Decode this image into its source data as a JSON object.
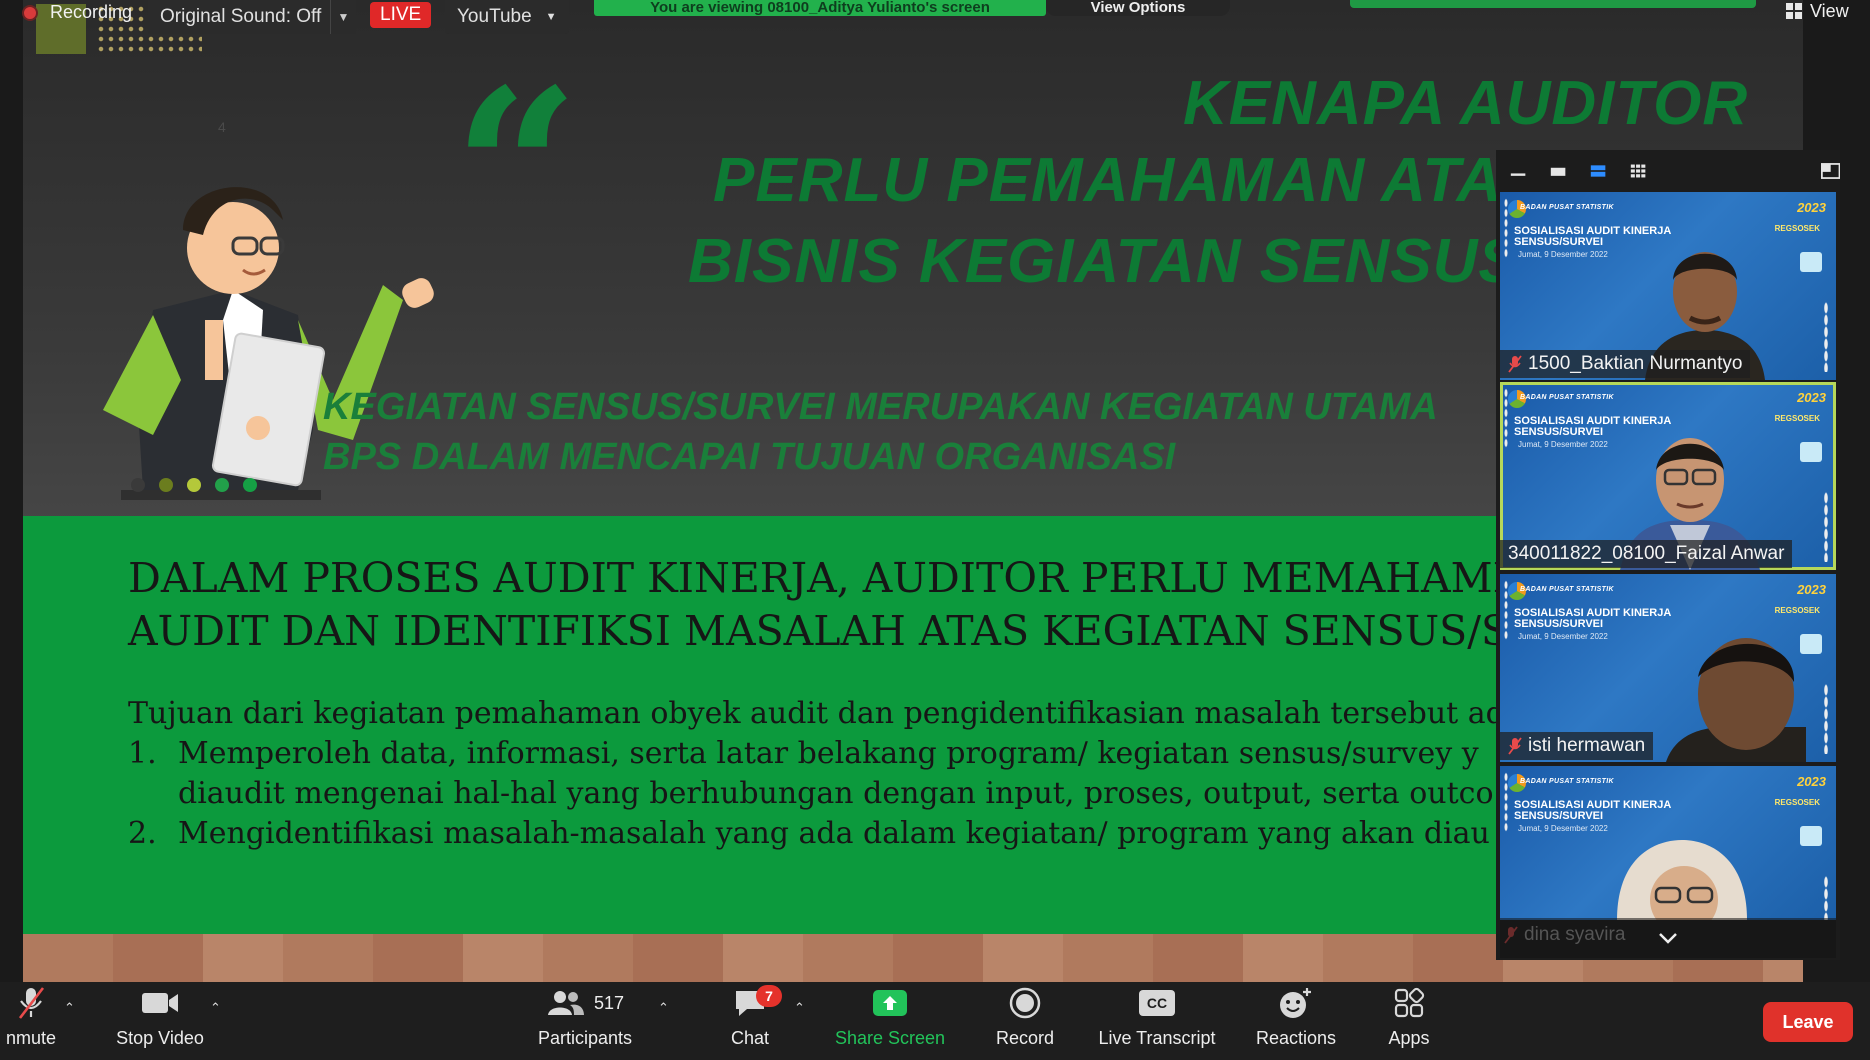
{
  "top_bar": {
    "recording_label": "Recording",
    "original_sound": "Original Sound: Off",
    "live_badge": "LIVE",
    "stream_target": "YouTube",
    "viewing_banner": "You are viewing 08100_Aditya Yulianto's screen",
    "view_options": "View Options",
    "view_label": "View"
  },
  "slide": {
    "heading_1": "KENAPA AUDITOR",
    "heading_2": "PERLU PEMAHAMAN ATAS PR",
    "heading_3": "BISNIS KEGIATAN SENSUS/SU",
    "subheading_1": "KEGIATAN SENSUS/SURVEI MERUPAKAN KEGIATAN UTAMA",
    "subheading_2": "BPS DALAM MENCAPAI TUJUAN ORGANISASI",
    "band_title_1": "DALAM PROSES AUDIT KINERJA, AUDITOR PERLU MEMAHAMI OBY",
    "band_title_2": "AUDIT DAN IDENTIFIKSI MASALAH ATAS KEGIATAN SENSUS/SURV",
    "intro": "Tujuan dari kegiatan pemahaman obyek audit dan pengidentifikasian masalah tersebut ad",
    "item_1_num": "1.",
    "item_1_line_1": "Memperoleh data, informasi, serta latar belakang  program/ kegiatan sensus/survey y",
    "item_1_line_2": "diaudit mengenai hal-hal yang berhubungan dengan input, proses, output, serta outco",
    "item_2_num": "2.",
    "item_2_line_1": "Mengidentifikasi masalah-masalah yang ada dalam kegiatan/ program yang akan diau",
    "dot_colors": [
      "#3a3a3a",
      "#6b7d1e",
      "#b4c83a",
      "#22a04a",
      "#15a045"
    ]
  },
  "gallery": {
    "tile_common": {
      "org": "BADAN PUSAT STATISTIK",
      "year": "2023",
      "title": "SOSIALISASI AUDIT KINERJA SENSUS/SURVEI",
      "date": "Jumat, 9 Desember 2022",
      "regsosek": "REGSOSEK"
    },
    "participants": [
      {
        "name": "1500_Baktian Nurmantyo",
        "muted": true
      },
      {
        "name": "340011822_08100_Faizal Anwar",
        "muted": false
      },
      {
        "name": "isti hermawan",
        "muted": true
      },
      {
        "name": "dina syavira",
        "muted": true
      }
    ]
  },
  "toolbar": {
    "unmute": "nmute",
    "stop_video": "Stop Video",
    "participants": "Participants",
    "participant_count": "517",
    "chat": "Chat",
    "chat_badge": "7",
    "share_screen": "Share Screen",
    "record": "Record",
    "live_transcript": "Live Transcript",
    "cc_icon_text": "CC",
    "reactions": "Reactions",
    "apps": "Apps",
    "leave": "Leave"
  },
  "colors": {
    "share_green": "#22c35a",
    "leave_red": "#e0322b",
    "active_speaker": "#b6d85a"
  }
}
